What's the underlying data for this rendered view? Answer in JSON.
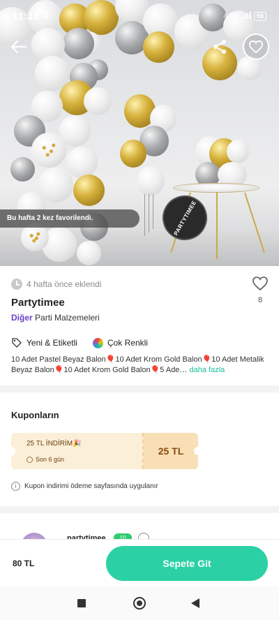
{
  "status_bar": {
    "time": "11:31",
    "network": "4.5G",
    "battery": "59"
  },
  "hero": {
    "favorite_toast": "Bu hafta 2 kez favorilendi.",
    "logo_text": "PARTYTIMEE"
  },
  "listing": {
    "added_time": "4 hafta önce eklendi",
    "like_count": "8",
    "shop_name": "Partytimee",
    "category_main": "Diğer",
    "category_sub": "Parti Malzemeleri",
    "tags": [
      {
        "label": "Yeni & Etiketli",
        "icon": "tag-icon"
      },
      {
        "label": "Çok Renkli",
        "icon": "color-palette-icon"
      }
    ],
    "description": "10 Adet Pastel Beyaz Balon🎈10 Adet Krom Gold Balon🎈10 Adet Metalik Beyaz Balon🎈10 Adet Krom Gold Balon🎈5 Ade…",
    "more_link": "daha fazla"
  },
  "coupons": {
    "title": "Kuponların",
    "coupon": {
      "name": "25 TL İNDİRİM🎉",
      "days_left": "Son 6 gün",
      "amount": "25 TL"
    },
    "note": "Kupon indirimi ödeme sayfasında uygulanır"
  },
  "seller": {
    "name": "partytimee",
    "badge": "10"
  },
  "bottom": {
    "price": "80 TL",
    "cart_button": "Sepete Git"
  },
  "colors": {
    "accent": "#2bd1a4",
    "category": "#6a3ec8",
    "more_link": "#1abc9c",
    "coupon_bg": "#fcefd8"
  }
}
